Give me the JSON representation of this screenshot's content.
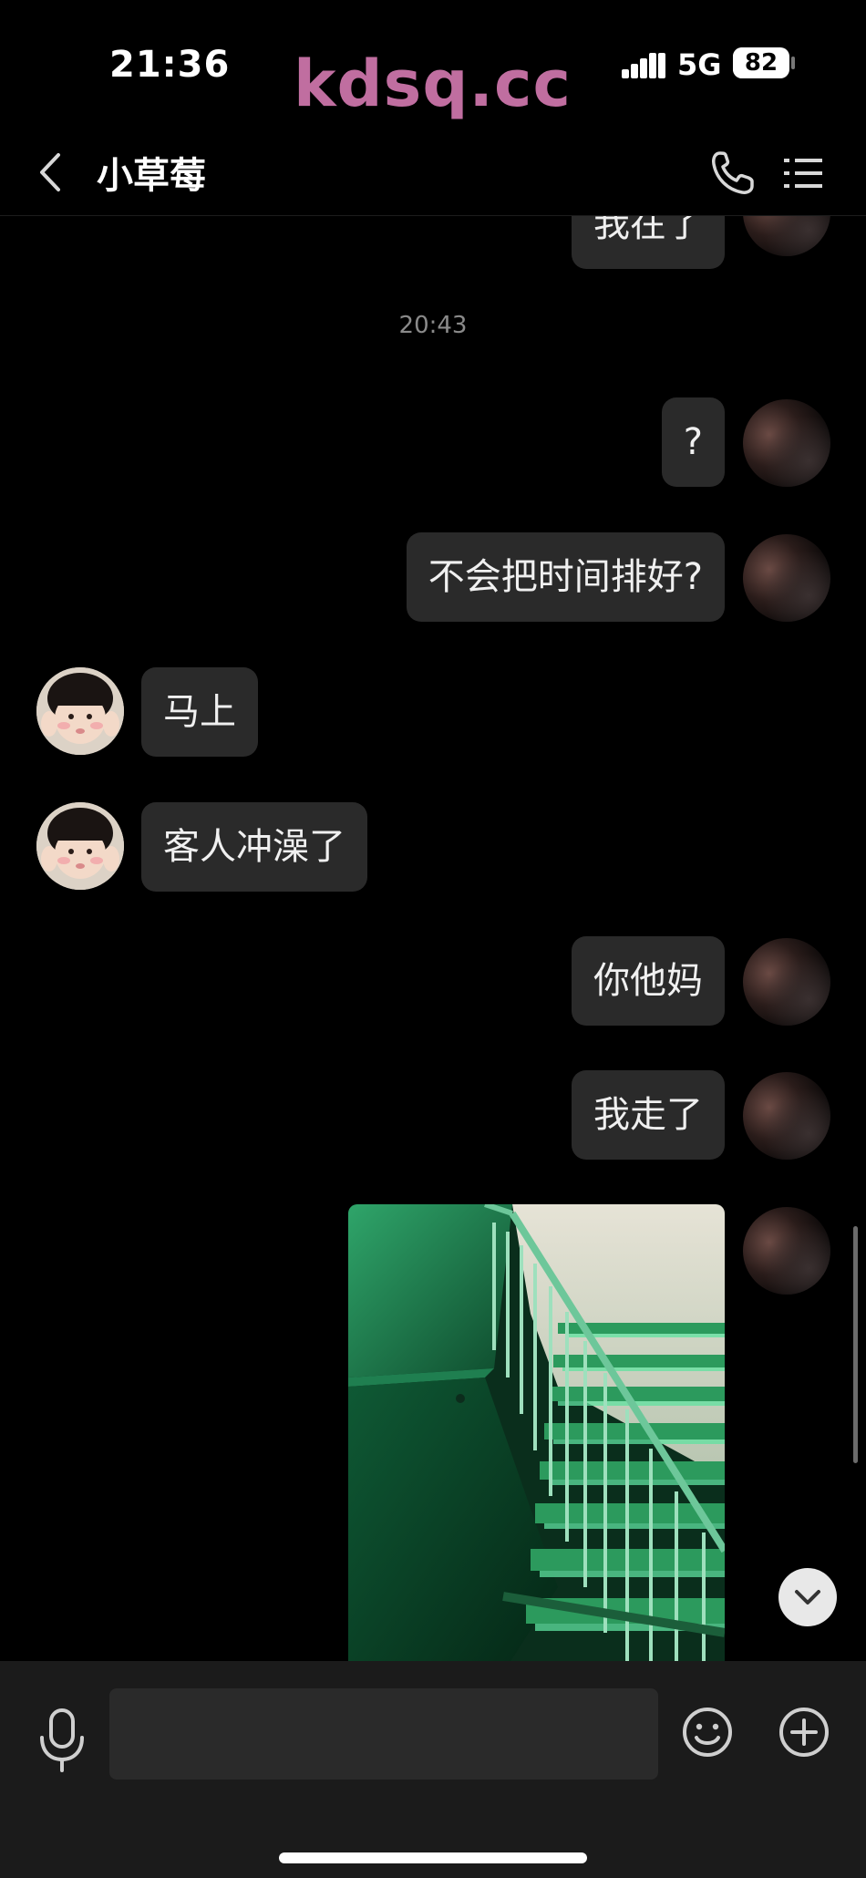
{
  "status_bar": {
    "time": "21:36",
    "watermark": "kdsq.cc",
    "network": "5G",
    "battery": "82",
    "battery_fraction": 0.82
  },
  "header": {
    "title": "小草莓",
    "icons": [
      "chevron-left-icon",
      "phone-icon",
      "menu-icon"
    ]
  },
  "messages": [
    {
      "type": "text",
      "direction": "outgoing",
      "text": "我在了",
      "partially_visible": true
    },
    {
      "type": "timestamp",
      "text": "20:43"
    },
    {
      "type": "text",
      "direction": "outgoing",
      "text": "?"
    },
    {
      "type": "text",
      "direction": "outgoing",
      "text": "不会把时间排好?"
    },
    {
      "type": "text",
      "direction": "incoming",
      "text": "马上"
    },
    {
      "type": "text",
      "direction": "incoming",
      "text": "客人冲澡了"
    },
    {
      "type": "text",
      "direction": "outgoing",
      "text": "你他妈"
    },
    {
      "type": "text",
      "direction": "outgoing",
      "text": "我走了"
    },
    {
      "type": "image",
      "direction": "outgoing",
      "subject": "green-lit stairwell photo"
    }
  ],
  "input_bar": {
    "placeholder": "",
    "icons": [
      "microphone-icon",
      "emoji-icon",
      "plus-icon"
    ]
  },
  "colors": {
    "background": "#000000",
    "bubble": "#2a2a2a",
    "input_bar": "#1b1b1b",
    "watermark": "#c06ea0",
    "timestamp": "#8a8a8a"
  }
}
